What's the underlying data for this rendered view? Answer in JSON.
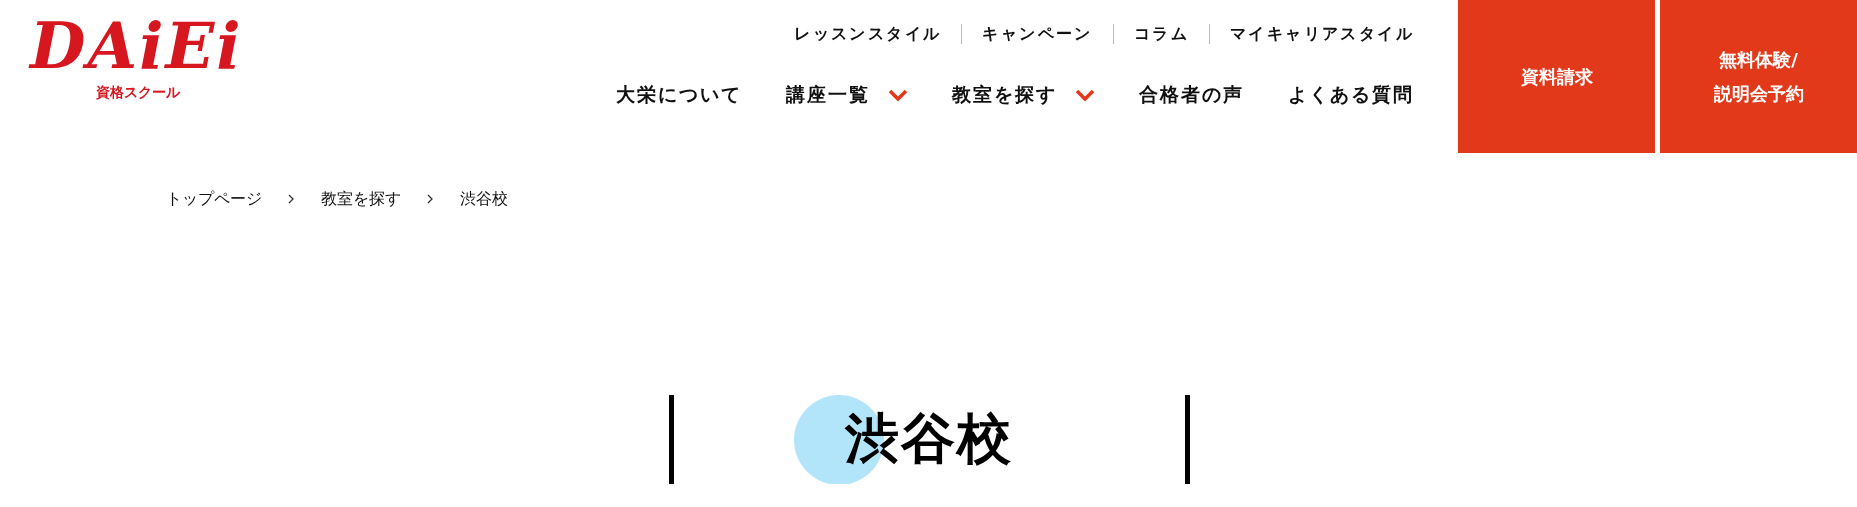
{
  "logo": {
    "text": "DAiEi",
    "subtitle": "資格スクール"
  },
  "top_links": [
    "レッスンスタイル",
    "キャンペーン",
    "コラム",
    "マイキャリアスタイル"
  ],
  "main_nav": [
    {
      "label": "大栄について",
      "dropdown": false
    },
    {
      "label": "講座一覧",
      "dropdown": true
    },
    {
      "label": "教室を探す",
      "dropdown": true
    },
    {
      "label": "合格者の声",
      "dropdown": false
    },
    {
      "label": "よくある質問",
      "dropdown": false
    }
  ],
  "buttons": [
    {
      "lines": [
        "資料請求"
      ]
    },
    {
      "lines": [
        "無料体験/",
        "説明会予約"
      ]
    }
  ],
  "breadcrumb": [
    "トップページ",
    "教室を探す",
    "渋谷校"
  ],
  "title": "渋谷校"
}
